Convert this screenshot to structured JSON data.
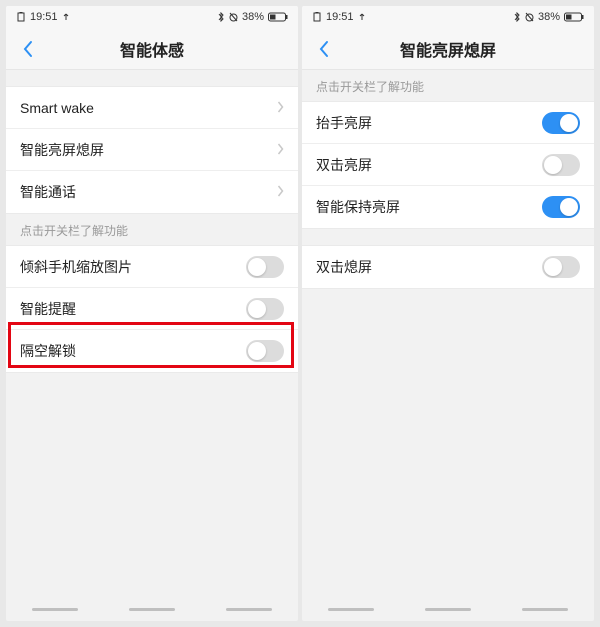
{
  "status": {
    "time": "19:51",
    "battery_pct": "38%"
  },
  "left": {
    "title": "智能体感",
    "nav_items": [
      {
        "label": "Smart wake"
      },
      {
        "label": "智能亮屏熄屏"
      },
      {
        "label": "智能通话"
      }
    ],
    "section_label": "点击开关栏了解功能",
    "toggles": [
      {
        "label": "倾斜手机缩放图片",
        "on": false
      },
      {
        "label": "智能提醒",
        "on": false
      },
      {
        "label": "隔空解锁",
        "on": false,
        "highlighted": true
      }
    ]
  },
  "right": {
    "title": "智能亮屏熄屏",
    "section_label": "点击开关栏了解功能",
    "toggles_a": [
      {
        "label": "抬手亮屏",
        "on": true
      },
      {
        "label": "双击亮屏",
        "on": false
      },
      {
        "label": "智能保持亮屏",
        "on": true
      }
    ],
    "toggles_b": [
      {
        "label": "双击熄屏",
        "on": false
      }
    ]
  }
}
